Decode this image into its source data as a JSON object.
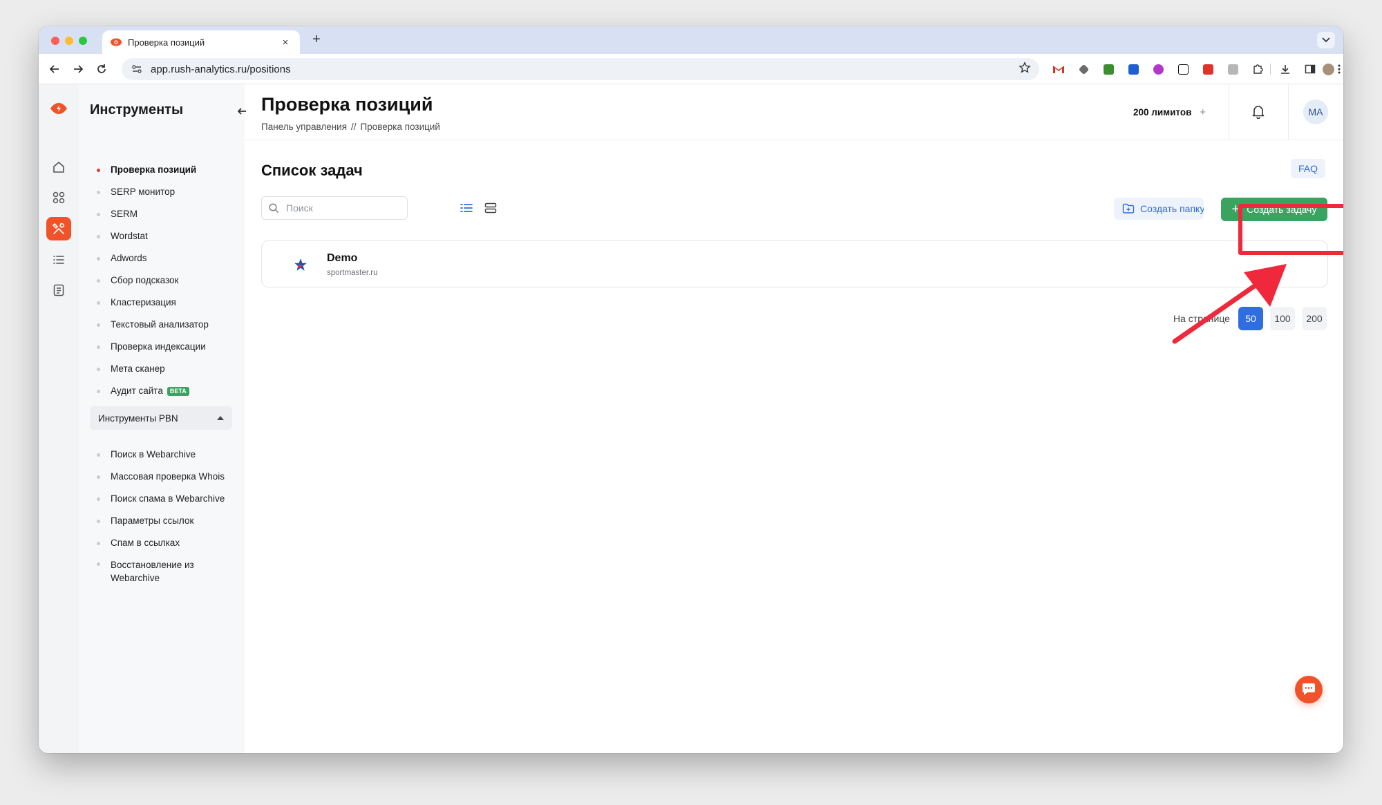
{
  "browser": {
    "tab_title": "Проверка позиций",
    "new_tab_symbol": "+",
    "close_symbol": "×",
    "url": "app.rush-analytics.ru/positions"
  },
  "app": {
    "panel_title": "Инструменты",
    "page_title": "Проверка позиций",
    "breadcrumb": [
      "Панель управления",
      "//",
      "Проверка позиций"
    ],
    "limits": "200 лимитов",
    "limits_plus": "+",
    "avatar_initials": "MA",
    "menu": [
      {
        "label": "Проверка позиций",
        "active": true
      },
      {
        "label": "SERP монитор"
      },
      {
        "label": "SERM"
      },
      {
        "label": "Wordstat"
      },
      {
        "label": "Adwords"
      },
      {
        "label": "Сбор подсказок"
      },
      {
        "label": "Кластеризация"
      },
      {
        "label": "Текстовый анализатор"
      },
      {
        "label": "Проверка индексации"
      },
      {
        "label": "Мета сканер"
      },
      {
        "label": "Аудит сайта",
        "badge": "BETA"
      }
    ],
    "pbn_section": "Инструменты PBN",
    "pbn_menu": [
      {
        "label": "Поиск в Webarchive"
      },
      {
        "label": "Массовая проверка Whois"
      },
      {
        "label": "Поиск спама в Webarchive"
      },
      {
        "label": "Параметры ссылок"
      },
      {
        "label": "Спам в ссылках"
      },
      {
        "label": "Восстановление из Webarchive"
      }
    ],
    "section_title": "Список задач",
    "faq": "FAQ",
    "search_placeholder": "Поиск",
    "create_folder": "Создать папку",
    "create_task": "Создать задачу",
    "create_task_plus": "+",
    "tasks": [
      {
        "name": "Demo",
        "domain": "sportmaster.ru"
      }
    ],
    "per_page_label": "На странице",
    "per_page_options": [
      "50",
      "100",
      "200"
    ],
    "per_page_selected": "50"
  },
  "colors": {
    "brand": "#f0532a",
    "create_button": "#3aa360",
    "link_blue": "#2e6bd6",
    "active_pagination": "#2f6de1",
    "annotation_red": "#f0283c"
  },
  "icons": {
    "rail": [
      "home-icon",
      "apps-icon",
      "tools-icon",
      "list-icon",
      "document-icon"
    ],
    "header": [
      "bell-icon"
    ],
    "extensions": [
      "gmail-icon",
      "extension-icon",
      "extension-icon",
      "extension-icon",
      "extension-icon",
      "notion-icon",
      "extension-icon",
      "extension-icon",
      "puzzle-icon",
      "download-icon",
      "sidebar-icon",
      "profile-icon",
      "more-icon"
    ]
  }
}
